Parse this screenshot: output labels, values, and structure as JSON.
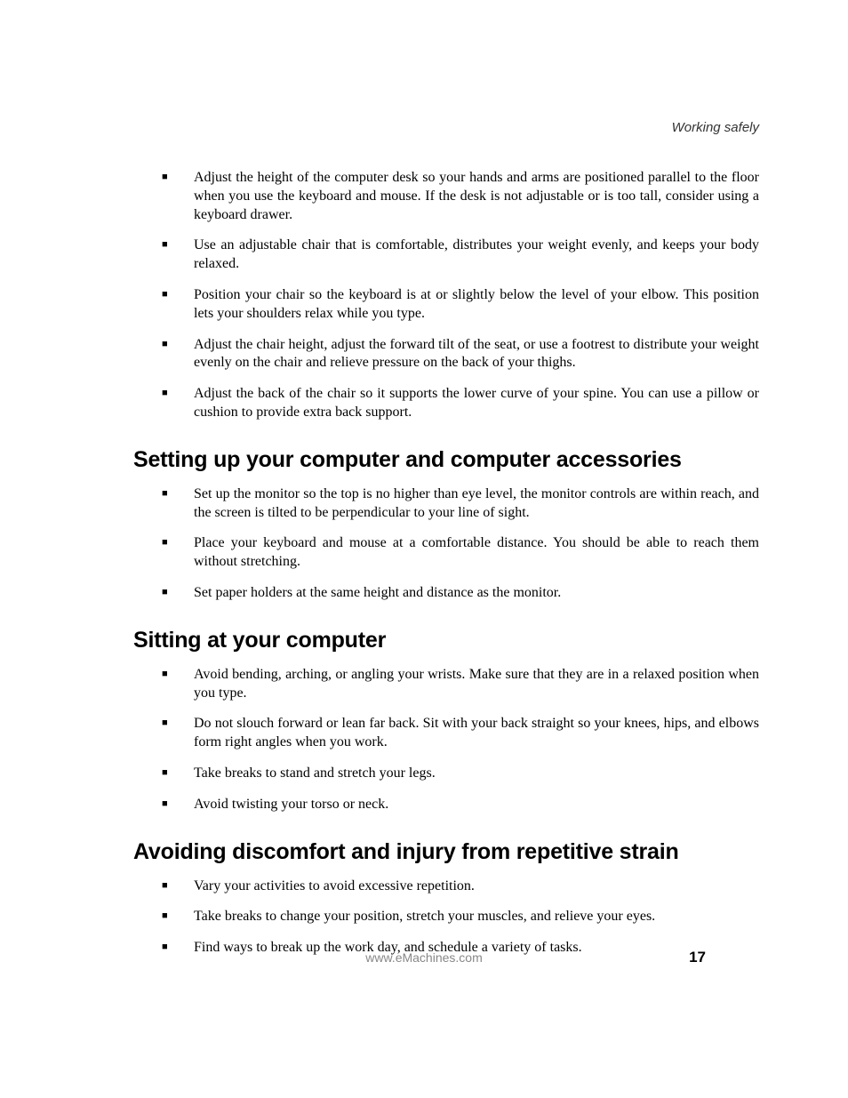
{
  "header": {
    "section_label": "Working safely"
  },
  "sections": [
    {
      "heading": null,
      "items": [
        "Adjust the height of the computer desk so your hands and arms are positioned parallel to the floor when you use the keyboard and mouse. If the desk is not adjustable or is too tall, consider using a keyboard drawer.",
        "Use an adjustable chair that is comfortable, distributes your weight evenly, and keeps your body relaxed.",
        "Position your chair so the keyboard is at or slightly below the level of your elbow. This position lets your shoulders relax while you type.",
        "Adjust the chair height, adjust the forward tilt of the seat, or use a footrest to distribute your weight evenly on the chair and relieve pressure on the back of your thighs.",
        "Adjust the back of the chair so it supports the lower curve of your spine. You can use a pillow or cushion to provide extra back support."
      ]
    },
    {
      "heading": "Setting up your computer and computer accessories",
      "items": [
        "Set up the monitor so the top is no higher than eye level, the monitor controls are within reach, and the screen is tilted to be perpendicular to your line of sight.",
        "Place your keyboard and mouse at a comfortable distance. You should be able to reach them without stretching.",
        "Set paper holders at the same height and distance as the monitor."
      ]
    },
    {
      "heading": "Sitting at your computer",
      "items": [
        "Avoid bending, arching, or angling your wrists. Make sure that they are in a relaxed position when you type.",
        "Do not slouch forward or lean far back. Sit with your back straight so your knees, hips, and elbows form right angles when you work.",
        "Take breaks to stand and stretch your legs.",
        "Avoid twisting your torso or neck."
      ]
    },
    {
      "heading": "Avoiding discomfort and injury from repetitive strain",
      "items": [
        "Vary your activities to avoid excessive repetition.",
        "Take breaks to change your position, stretch your muscles, and relieve your eyes.",
        "Find ways to break up the work day, and schedule a variety of tasks."
      ]
    }
  ],
  "footer": {
    "url": "www.eMachines.com",
    "page_number": "17"
  }
}
